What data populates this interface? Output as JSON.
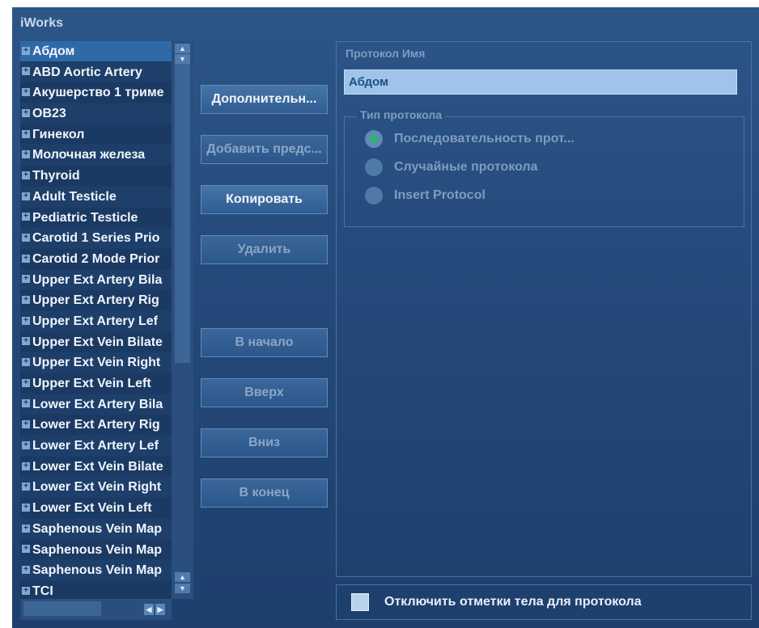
{
  "app_title": "iWorks",
  "protocol_list": [
    "Абдом",
    "ABD Aortic Artery",
    "Акушерство 1 триме",
    "OB23",
    "Гинекол",
    "Молочная железа",
    "Thyroid",
    "Adult Testicle",
    "Pediatric Testicle",
    "Carotid 1 Series Prio",
    "Carotid 2 Mode Prior",
    "Upper Ext Artery Bila",
    "Upper Ext Artery Rig",
    "Upper Ext Artery Lef",
    "Upper Ext Vein Bilate",
    "Upper Ext Vein Right",
    "Upper Ext Vein Left",
    "Lower Ext Artery Bila",
    "Lower Ext Artery Rig",
    "Lower Ext Artery Lef",
    "Lower Ext Vein Bilate",
    "Lower Ext Vein Right",
    "Lower Ext Vein Left",
    "Saphenous Vein Map",
    "Saphenous Vein Map",
    "Saphenous Vein Map",
    "TCI"
  ],
  "selected_index": 0,
  "buttons": {
    "more": "Дополнительн...",
    "add_preset": "Добавить предс...",
    "copy": "Копировать",
    "delete": "Удалить",
    "to_top": "В начало",
    "up": "Вверх",
    "down": "Вниз",
    "to_end": "В конец"
  },
  "protocol_name_label": "Протокол Имя",
  "protocol_name_value": "Абдом",
  "protocol_type_label": "Тип протокола",
  "protocol_types": [
    {
      "label": "Последовательность прот...",
      "checked": true
    },
    {
      "label": "Случайные протокола",
      "checked": false
    },
    {
      "label": "Insert Protocol",
      "checked": false
    }
  ],
  "disable_body_marks_label": "Отключить отметки тела для протокола",
  "disable_body_marks_checked": false,
  "colors": {
    "background": "#24497a",
    "selected": "#2f6aa8",
    "radio_checked": "#2fb46b"
  }
}
